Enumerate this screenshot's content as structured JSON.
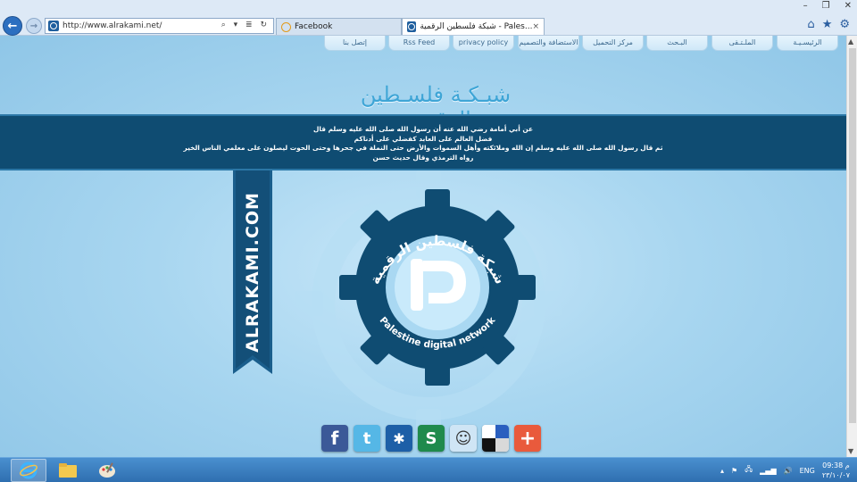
{
  "browser": {
    "url": "http://www.alrakami.net/",
    "tabs": [
      {
        "label": "Facebook",
        "active": false
      },
      {
        "label": "شبكة فلسطين الرقمية - Pales...",
        "active": true
      }
    ],
    "tab_close": "×",
    "window_controls": [
      "–",
      "❐",
      "✕"
    ],
    "addr_tools": "⌕ ▾ ≣ ↻"
  },
  "site": {
    "nav": [
      "الرئيسـيـة",
      "الملـتـقى",
      "البـحث",
      "مركز التحميل",
      "الاستضافة والتصميم",
      "privacy policy",
      "Rss Feed",
      "إتصل بنا"
    ],
    "logo_text": "شبـكـة فلسـطين الرقـمية",
    "hadith_lines": [
      "عن أبي أمامة رضي الله عنه أن رسول الله صلى الله عليه وسلم قال",
      "فضل العالم على العابد كفضلي على أدناكم",
      "ثم قال رسول الله صلى الله عليه وسلم إن الله وملائكته وأهل السموات والأرض حتى النملة في جحرها وحتى الحوت ليصلون على معلمي الناس الخير",
      "رواه الترمذي وقال حديث حسن"
    ],
    "ribbon_text": "ALRAKAMI.COM",
    "emblem_arabic": "شبكة فلسطين الرقمية",
    "emblem_english": "Palestine digital network"
  },
  "social": [
    {
      "name": "facebook",
      "glyph": "f",
      "color": "#3b5998"
    },
    {
      "name": "twitter",
      "glyph": "t",
      "color": "#55b7e6"
    },
    {
      "name": "myspace",
      "glyph": "✱",
      "color": "#1d5fa7"
    },
    {
      "name": "stumbleupon",
      "glyph": "S",
      "color": "#1f8a4c"
    },
    {
      "name": "reddit",
      "glyph": "☺",
      "color": "#cfe5f5"
    },
    {
      "name": "delicious",
      "glyph": "",
      "color": "#ffffff"
    },
    {
      "name": "google-plus",
      "glyph": "+",
      "color": "#e95a3c"
    }
  ],
  "taskbar": {
    "language": "ENG",
    "time": "09:38 م",
    "date": "٢٣/١٠/٠٧"
  }
}
